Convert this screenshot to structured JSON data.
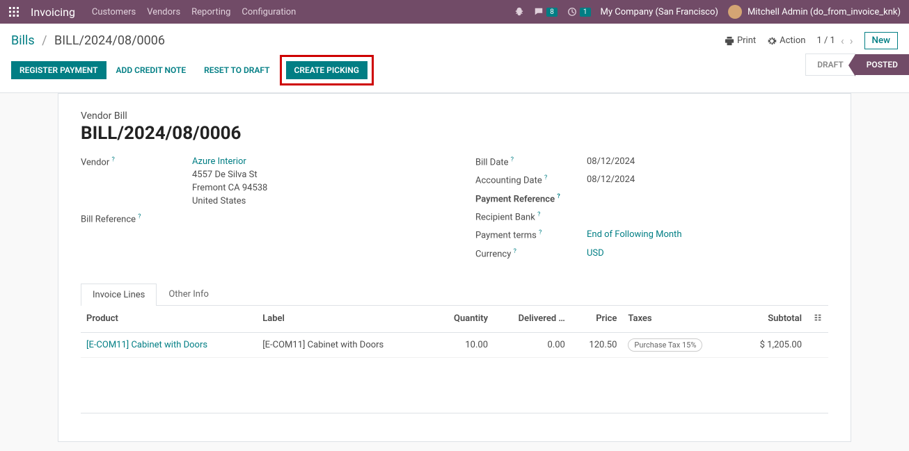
{
  "nav": {
    "app": "Invoicing",
    "links": [
      "Customers",
      "Vendors",
      "Reporting",
      "Configuration"
    ],
    "chat_count": "8",
    "clock_count": "1",
    "company": "My Company (San Francisco)",
    "user": "Mitchell Admin (do_from_invoice_knk)"
  },
  "breadcrumb": {
    "root": "Bills",
    "current": "BILL/2024/08/0006"
  },
  "cp": {
    "print": "Print",
    "action": "Action",
    "pager": "1 / 1",
    "new": "New"
  },
  "buttons": {
    "register_payment": "REGISTER PAYMENT",
    "add_credit_note": "ADD CREDIT NOTE",
    "reset_to_draft": "RESET TO DRAFT",
    "create_picking": "CREATE PICKING"
  },
  "status": {
    "draft": "DRAFT",
    "posted": "POSTED"
  },
  "sheet": {
    "subtitle": "Vendor Bill",
    "title": "BILL/2024/08/0006",
    "left": {
      "vendor_lbl": "Vendor",
      "vendor_name": "Azure Interior",
      "vendor_addr1": "4557 De Silva St",
      "vendor_addr2": "Fremont CA 94538",
      "vendor_addr3": "United States",
      "billref_lbl": "Bill Reference"
    },
    "right": {
      "billdate_lbl": "Bill Date",
      "billdate": "08/12/2024",
      "acctdate_lbl": "Accounting Date",
      "acctdate": "08/12/2024",
      "payref_lbl": "Payment Reference",
      "recbank_lbl": "Recipient Bank",
      "terms_lbl": "Payment terms",
      "terms": "End of Following Month",
      "currency_lbl": "Currency",
      "currency": "USD"
    }
  },
  "tabs": {
    "lines": "Invoice Lines",
    "other": "Other Info"
  },
  "table": {
    "headers": {
      "product": "Product",
      "label": "Label",
      "qty": "Quantity",
      "delivered": "Delivered …",
      "price": "Price",
      "taxes": "Taxes",
      "subtotal": "Subtotal"
    },
    "rows": [
      {
        "product": "[E-COM11] Cabinet with Doors",
        "label": "[E-COM11] Cabinet with Doors",
        "qty": "10.00",
        "delivered": "0.00",
        "price": "120.50",
        "tax": "Purchase Tax 15%",
        "subtotal": "$ 1,205.00"
      }
    ]
  }
}
